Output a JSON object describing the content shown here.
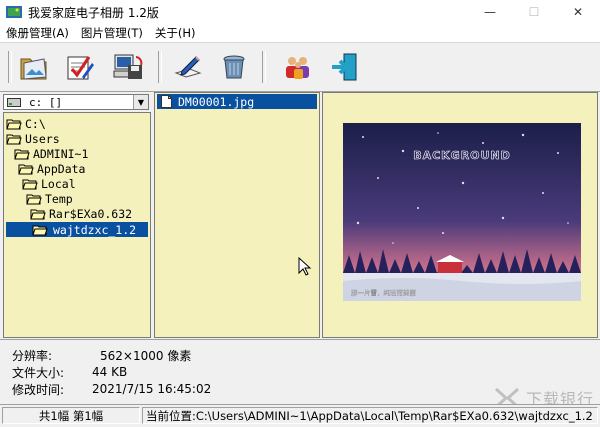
{
  "window": {
    "title": "我爱家庭电子相册 1.2版",
    "minimize": "—",
    "maximize": "☐",
    "close": "✕"
  },
  "menu": [
    {
      "label": "像册管理(A)"
    },
    {
      "label": "图片管理(T)"
    },
    {
      "label": "关于(H)"
    }
  ],
  "toolbar": {
    "buttons": [
      {
        "icon": "open-album-icon"
      },
      {
        "icon": "edit-check-icon"
      },
      {
        "icon": "computer-save-icon"
      },
      {
        "icon": "pencil-edit-icon"
      },
      {
        "icon": "recycle-bin-icon"
      },
      {
        "icon": "people-icon"
      },
      {
        "icon": "exit-door-icon"
      }
    ]
  },
  "drive": {
    "label": "c: []"
  },
  "tree": [
    {
      "label": "C:\\",
      "selected": false
    },
    {
      "label": "Users",
      "selected": false
    },
    {
      "label": "ADMINI~1",
      "selected": false
    },
    {
      "label": "AppData",
      "selected": false
    },
    {
      "label": "Local",
      "selected": false
    },
    {
      "label": "Temp",
      "selected": false
    },
    {
      "label": "Rar$EXa0.632",
      "selected": false
    },
    {
      "label": "wajtdzxc_1.2",
      "selected": true
    }
  ],
  "files": [
    {
      "name": "DM00001.jpg",
      "selected": true
    }
  ],
  "preview": {
    "image_text": "BACKGROUND",
    "caption": "那一片雪，纯洁而美丽"
  },
  "info": {
    "resolution_label": "分辨率:",
    "resolution_value": "562×1000 像素",
    "size_label": "文件大小:",
    "size_value": "44 KB",
    "modified_label": "修改时间:",
    "modified_value": "2021/7/15 16:45:02"
  },
  "status": {
    "count": "共1幅 第1幅",
    "path": "当前位置:C:\\Users\\ADMINI~1\\AppData\\Local\\Temp\\Rar$EXa0.632\\wajtdzxc_1.2"
  },
  "watermark": {
    "text": "下载银行"
  },
  "colors": {
    "pane_bg": "#f5f1bd",
    "selection": "#0a50a1"
  }
}
